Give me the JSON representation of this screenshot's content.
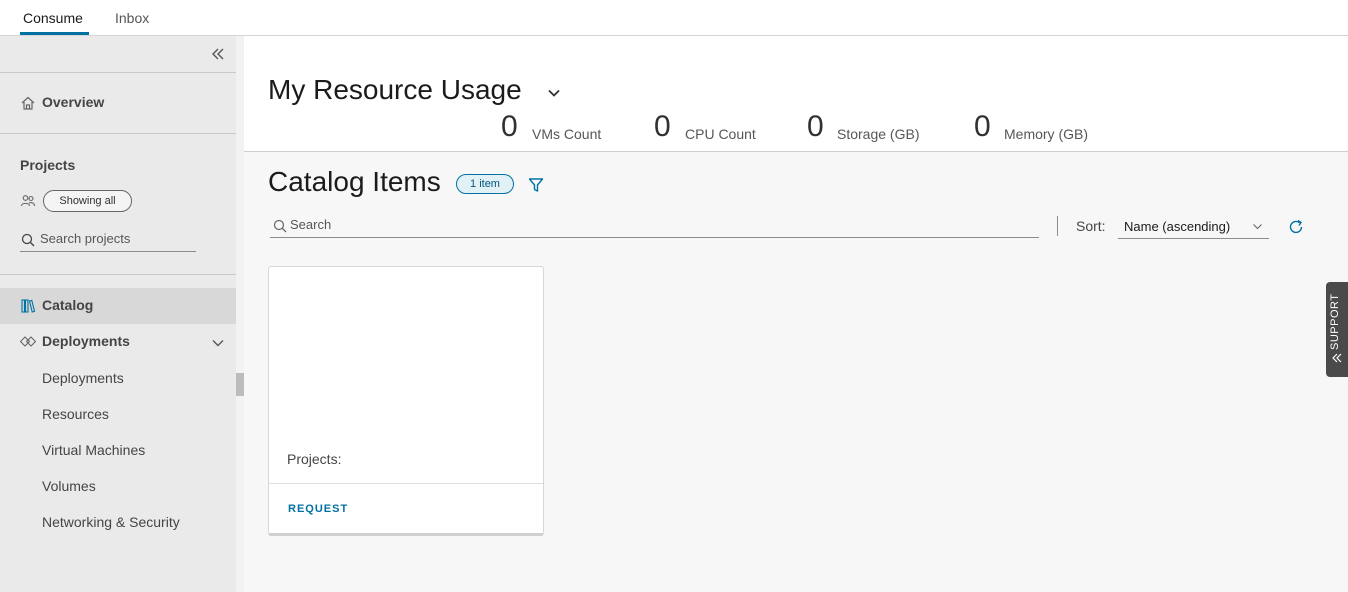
{
  "tabs": [
    {
      "label": "Consume",
      "active": true
    },
    {
      "label": "Inbox",
      "active": false
    }
  ],
  "sidebar": {
    "overview_label": "Overview",
    "projects": {
      "title": "Projects",
      "filter_chip": "Showing all",
      "search_placeholder": "Search projects"
    },
    "catalog_label": "Catalog",
    "deployments_label": "Deployments",
    "deployment_items": [
      "Deployments",
      "Resources",
      "Virtual Machines",
      "Volumes",
      "Networking & Security"
    ]
  },
  "usage": {
    "title": "My Resource Usage",
    "stats": [
      {
        "value": "0",
        "label": "VMs Count"
      },
      {
        "value": "0",
        "label": "CPU Count"
      },
      {
        "value": "0",
        "label": "Storage (GB)"
      },
      {
        "value": "0",
        "label": "Memory (GB)"
      }
    ]
  },
  "catalog": {
    "title": "Catalog Items",
    "count_badge": "1 item",
    "search_placeholder": "Search",
    "sort_label": "Sort:",
    "sort_value": "Name (ascending)",
    "card": {
      "projects_label": "Projects:",
      "request_label": "REQUEST"
    }
  },
  "support_label": "SUPPORT",
  "colors": {
    "accent": "#0072a3",
    "sidebar_bg": "#eaeaea",
    "active_nav_bg": "#d8d8d8"
  }
}
